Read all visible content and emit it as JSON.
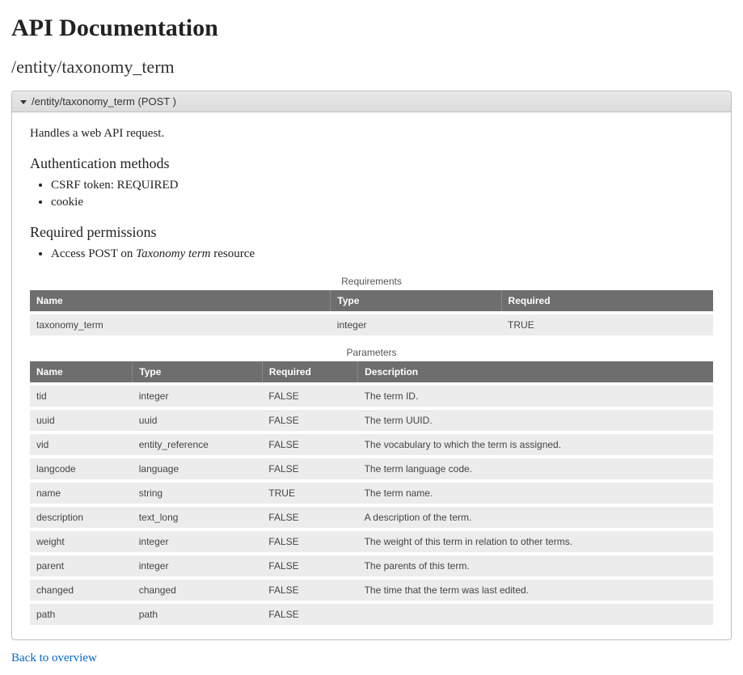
{
  "page": {
    "title": "API Documentation",
    "endpoint_path": "/entity/taxonomy_term"
  },
  "panel": {
    "header": "/entity/taxonomy_term (POST )",
    "intro": "Handles a web API request."
  },
  "auth": {
    "heading": "Authentication methods",
    "items": [
      "CSRF token: REQUIRED",
      "cookie"
    ]
  },
  "perms": {
    "heading": "Required permissions",
    "items_pre": [
      "Access POST on "
    ],
    "items_em": [
      "Taxonomy term"
    ],
    "items_post": [
      " resource"
    ]
  },
  "requirements": {
    "caption": "Requirements",
    "headers": [
      "Name",
      "Type",
      "Required"
    ],
    "rows": [
      {
        "name": "taxonomy_term",
        "type": "integer",
        "required": "TRUE"
      }
    ]
  },
  "parameters": {
    "caption": "Parameters",
    "headers": [
      "Name",
      "Type",
      "Required",
      "Description"
    ],
    "rows": [
      {
        "name": "tid",
        "type": "integer",
        "required": "FALSE",
        "description": "The term ID."
      },
      {
        "name": "uuid",
        "type": "uuid",
        "required": "FALSE",
        "description": "The term UUID."
      },
      {
        "name": "vid",
        "type": "entity_reference",
        "required": "FALSE",
        "description": "The vocabulary to which the term is assigned."
      },
      {
        "name": "langcode",
        "type": "language",
        "required": "FALSE",
        "description": "The term language code."
      },
      {
        "name": "name",
        "type": "string",
        "required": "TRUE",
        "description": "The term name."
      },
      {
        "name": "description",
        "type": "text_long",
        "required": "FALSE",
        "description": "A description of the term."
      },
      {
        "name": "weight",
        "type": "integer",
        "required": "FALSE",
        "description": "The weight of this term in relation to other terms."
      },
      {
        "name": "parent",
        "type": "integer",
        "required": "FALSE",
        "description": "The parents of this term."
      },
      {
        "name": "changed",
        "type": "changed",
        "required": "FALSE",
        "description": "The time that the term was last edited."
      },
      {
        "name": "path",
        "type": "path",
        "required": "FALSE",
        "description": ""
      }
    ]
  },
  "footer": {
    "back_link": "Back to overview"
  }
}
